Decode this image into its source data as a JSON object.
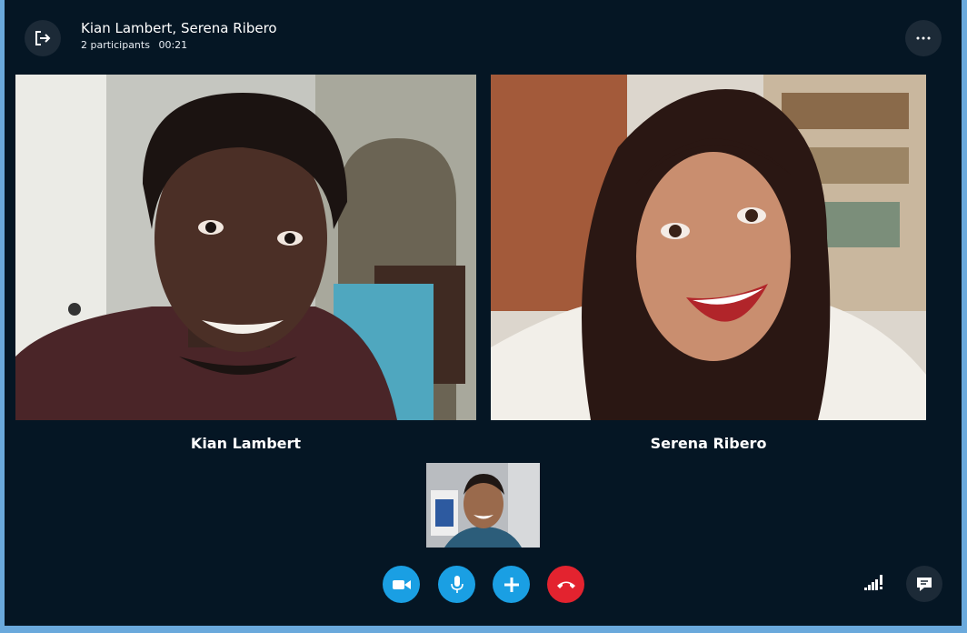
{
  "call": {
    "title": "Kian Lambert, Serena Ribero",
    "participants_label": "2 participants",
    "duration": "00:21"
  },
  "participants": [
    {
      "name": "Kian Lambert"
    },
    {
      "name": "Serena Ribero"
    }
  ],
  "controls": {
    "icons": [
      "video-camera-icon",
      "microphone-icon",
      "add-icon",
      "end-call-icon"
    ],
    "accent": "#1a9fe3",
    "end_call_color": "#e3232f"
  }
}
